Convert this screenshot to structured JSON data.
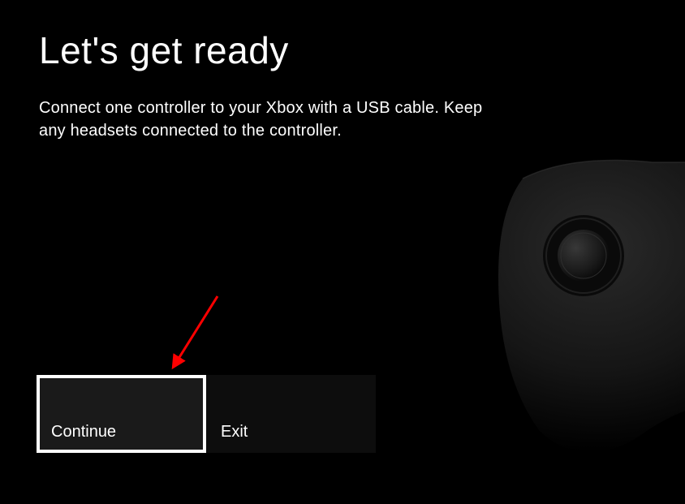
{
  "page": {
    "title": "Let's get ready",
    "description": "Connect one controller to your Xbox with a USB cable. Keep any headsets connected to the controller."
  },
  "buttons": {
    "continue": "Continue",
    "exit": "Exit"
  },
  "annotation": {
    "arrow_color": "#ff0000"
  }
}
